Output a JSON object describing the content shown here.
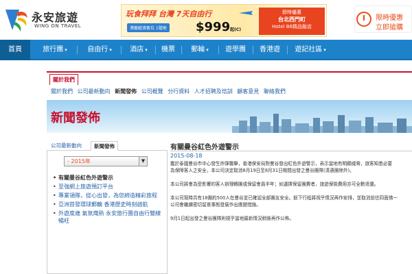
{
  "brand": {
    "name_cn": "永安旅遊",
    "name_en": "WING ON TRAVEL",
    "accent": "#1d82c9",
    "red": "#c8102e"
  },
  "banner": {
    "slogan": "玩食拜拜 台灣 7天自由行",
    "badge": "港龍經濟客位 1號地",
    "price": "$999",
    "price_suffix": "起(C)",
    "right_line1": "即時優惠",
    "right_line2": "台北西門町",
    "right_line3": "Hotel B6精品飯店"
  },
  "side_promo": {
    "line1": "限時優惠",
    "line2": "立即搶購"
  },
  "nav": {
    "items": [
      {
        "label": "首頁",
        "caret": false
      },
      {
        "label": "旅行團",
        "caret": true
      },
      {
        "label": "自由行",
        "caret": true
      },
      {
        "label": "酒店",
        "caret": true
      },
      {
        "label": "機票",
        "caret": false
      },
      {
        "label": "郵輪",
        "caret": true
      },
      {
        "label": "遊學團",
        "caret": false
      },
      {
        "label": "香港遊",
        "caret": false
      },
      {
        "label": "遊記社區",
        "caret": true
      }
    ]
  },
  "about": {
    "tab": "關於我們",
    "links": [
      "關於我們",
      "公司最新動向",
      "新聞發佈",
      "公司概覽",
      "分行資料",
      "人才招聘及培訓",
      "顧客意見",
      "聯絡我們"
    ]
  },
  "hero": {
    "title": "新聞發佈"
  },
  "left": {
    "tabs": [
      "公司最新動向",
      "新聞發佈"
    ],
    "select_value": "- 2015年",
    "items": [
      "有關曼谷紅色外遊警示",
      "至強網上旅遊預訂平台",
      "專業領隊，從心出發，為您締造精彩旅程",
      "亞洲首發環球郵輪 香港歷史時刻啟航",
      "外遊度歲 氣氛熾熱 永安旅行團自由行雙線暢旺"
    ]
  },
  "article": {
    "title": "有關曼谷紅色外遊警示",
    "date": "2015-08-18",
    "paragraphs": [
      [
        "鑑於泰國曼谷市中心發生炸彈襲擊，香港保安局對曼谷發出紅色外遊警示，表示當地有明顯威脅，旅客知悉必要",
        "為保障客人之安全，本公司決定取消8月19日至8月31日期間出發之曼谷團隊(清邁團除外)。"
      ],
      [
        "本公司將會為受影響的客人辦理轉團或保留會員半年；如選擇保留團費者，旅遊保險費用亦可全數退還。"
      ],
      [
        "本公司現時共有18團約500人在曼谷並已確認全部團友安全。餘下行程將視乎情況再作安排，並取消前往四面佛一",
        "公司會繼續密切留意事態發展作出應變措施。"
      ],
      [
        "9月1日起出發之曼谷團隊則視乎當地最新情況稍後再作公佈。"
      ]
    ]
  }
}
